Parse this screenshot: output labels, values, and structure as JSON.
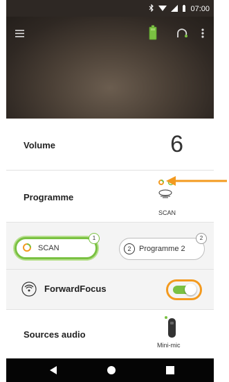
{
  "status_bar": {
    "time": "07:00",
    "icons": [
      "bluetooth-icon",
      "wifi-icon",
      "signal-icon",
      "battery-icon"
    ]
  },
  "app_bar": {
    "icons": [
      "menu-icon",
      "hearing-aid-battery-icon",
      "ear-icon",
      "more-options-icon"
    ]
  },
  "volume": {
    "label": "Volume",
    "value": "6"
  },
  "programme": {
    "label": "Programme",
    "current": "SCAN"
  },
  "programmes": [
    {
      "number": "1",
      "label": "SCAN",
      "active": true
    },
    {
      "number": "2",
      "label": "Programme 2",
      "active": false
    }
  ],
  "forward_focus": {
    "label": "ForwardFocus",
    "enabled": true
  },
  "audio_sources": {
    "label": "Sources audio",
    "device": "Mini-mic"
  },
  "colors": {
    "accent_green": "#7ac142",
    "highlight_orange": "#f39a1f",
    "header_dark": "#2e2824"
  }
}
